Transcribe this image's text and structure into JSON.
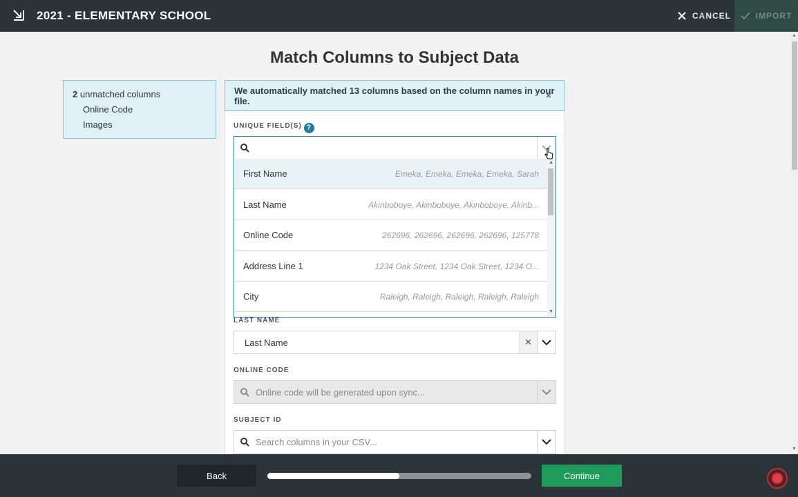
{
  "header": {
    "title": "2021 - ELEMENTARY SCHOOL",
    "cancel_label": "CANCEL",
    "import_label": "IMPORT",
    "icons": [
      "import-icon",
      "close-icon",
      "check-icon"
    ]
  },
  "page": {
    "title": "Match Columns to Subject Data"
  },
  "unmatched": {
    "count": "2",
    "count_label": "unmatched columns",
    "items": [
      "Online Code",
      "Images"
    ]
  },
  "notice": {
    "text": "We automatically matched 13 columns based on the column names in your file.",
    "close": "×"
  },
  "fields": {
    "unique_label": "UNIQUE FIELD(S)",
    "unique_value": "",
    "last_name_label": "LAST NAME",
    "last_name_value": "Last Name",
    "online_code_label": "ONLINE CODE",
    "online_code_placeholder": "Online code will be generated upon sync...",
    "subject_id_label": "SUBJECT ID",
    "subject_id_placeholder": "Search columns in your CSV..."
  },
  "dropdown": {
    "options": [
      {
        "name": "First Name",
        "sample": "Emeka, Emeka, Emeka, Emeka, Sarah"
      },
      {
        "name": "Last Name",
        "sample": "Akinboboye, Akinboboye, Akinboboye, Akinb..."
      },
      {
        "name": "Online Code",
        "sample": "262696, 262696, 262696, 262696, 125778"
      },
      {
        "name": "Address Line 1",
        "sample": "1234 Oak Street, 1234 Oak Street, 1234 O..."
      },
      {
        "name": "City",
        "sample": "Raleigh, Raleigh, Raleigh, Raleigh, Raleigh"
      }
    ]
  },
  "footer": {
    "back_label": "Back",
    "continue_label": "Continue",
    "progress_percent": 50
  },
  "colors": {
    "topbar": "#2c3439",
    "accent": "#1f7a9e",
    "continue": "#1e9a5a",
    "notice_bg": "#dff1f7"
  }
}
